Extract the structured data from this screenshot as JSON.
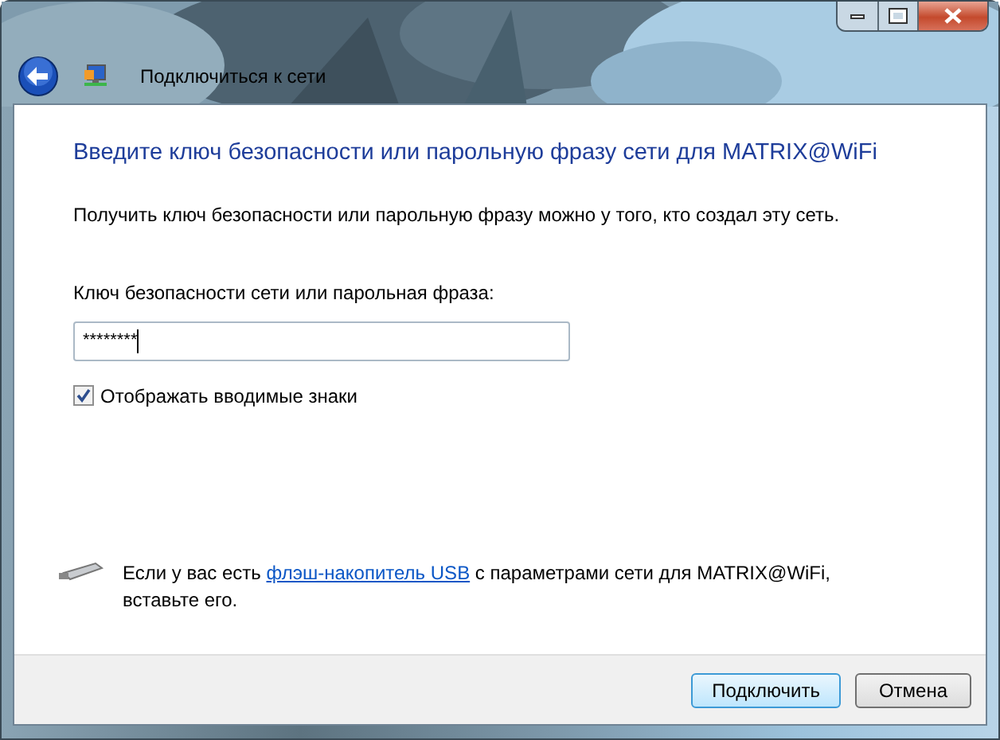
{
  "window": {
    "title": "Подключиться к сети"
  },
  "heading": "Введите ключ безопасности или парольную фразу сети для MATRIX@WiFi",
  "description": "Получить ключ безопасности или парольную фразу можно у того, кто создал эту сеть.",
  "key_field": {
    "label": "Ключ безопасности сети или парольная фраза:",
    "value": "********"
  },
  "show_characters": {
    "label": "Отображать вводимые знаки",
    "checked": true
  },
  "usb_note": {
    "before": "Если у вас есть",
    "link": "флэш-накопитель USB",
    "after": "с параметрами сети для MATRIX@WiFi, вставьте его."
  },
  "buttons": [
    {
      "label": "Подключить",
      "default": true
    },
    {
      "label": "Отмена",
      "default": false
    }
  ]
}
